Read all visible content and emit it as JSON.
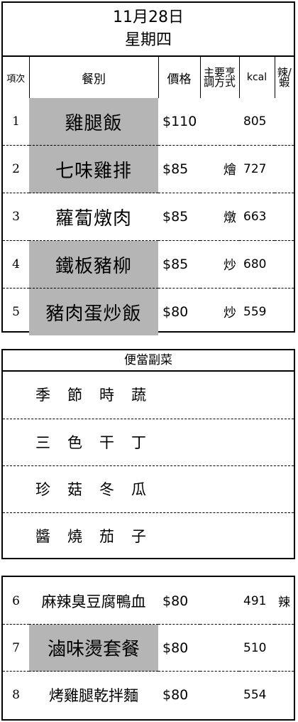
{
  "header": {
    "date": "11月28日",
    "weekday": "星期四"
  },
  "columns": {
    "index": "項次",
    "meal": "餐別",
    "price": "價格",
    "method": "主要烹調方式",
    "kcal": "kcal",
    "spicy": "辣/蝦"
  },
  "meals": [
    {
      "index": "1",
      "name": "雞腿飯",
      "price": "$110",
      "method": "",
      "kcal": "805",
      "spicy": "",
      "highlight": true
    },
    {
      "index": "2",
      "name": "七味雞排",
      "price": "$85",
      "method": "燴",
      "kcal": "727",
      "spicy": "",
      "highlight": true
    },
    {
      "index": "3",
      "name": "蘿蔔燉肉",
      "price": "$85",
      "method": "燉",
      "kcal": "663",
      "spicy": "",
      "highlight": false
    },
    {
      "index": "4",
      "name": "鐵板豬柳",
      "price": "$85",
      "method": "炒",
      "kcal": "680",
      "spicy": "",
      "highlight": true
    },
    {
      "index": "5",
      "name": "豬肉蛋炒飯",
      "price": "$80",
      "method": "炒",
      "kcal": "559",
      "spicy": "",
      "highlight": true
    }
  ],
  "side_dishes": {
    "title": "便當副菜",
    "items": [
      "季節時蔬",
      "三色干丁",
      "珍菇冬瓜",
      "醬燒茄子"
    ]
  },
  "extra_meals": [
    {
      "index": "6",
      "name": "麻辣臭豆腐鴨血",
      "price": "$80",
      "kcal": "491",
      "spicy": "辣",
      "highlight": false
    },
    {
      "index": "7",
      "name": "滷味燙套餐",
      "price": "$80",
      "kcal": "510",
      "spicy": "",
      "highlight": true
    },
    {
      "index": "8",
      "name": "烤雞腿乾拌麵",
      "price": "$80",
      "kcal": "554",
      "spicy": "",
      "highlight": false
    }
  ],
  "colors": {
    "highlight": "#b5b5b5",
    "border": "#000000",
    "background": "#ffffff"
  }
}
